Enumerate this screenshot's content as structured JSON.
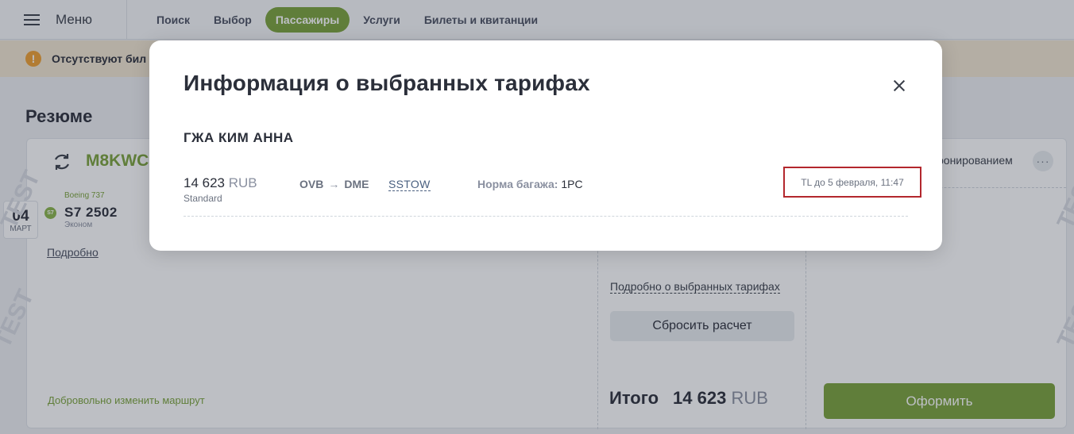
{
  "topbar": {
    "menu_label": "Меню",
    "tabs": [
      {
        "label": "Поиск",
        "active": false
      },
      {
        "label": "Выбор",
        "active": false
      },
      {
        "label": "Пассажиры",
        "active": true
      },
      {
        "label": "Услуги",
        "active": false
      },
      {
        "label": "Билеты и квитанции",
        "active": false
      }
    ]
  },
  "warning": {
    "icon": "exclamation-icon",
    "text": "Отсутствуют бил"
  },
  "summary": {
    "title": "Резюме",
    "pnr": "M8KWC",
    "date_day": "04",
    "date_month": "МАРТ",
    "carrier_code": "S7",
    "aircraft": "Boeing 737",
    "flight": "S7  2502",
    "cabin": "Эконом",
    "details_link": "Подробно",
    "change_route": "Добровольно изменить маршрут",
    "booking_hint": "ронированием",
    "fare_details_link": "Подробно о выбранных тарифах",
    "reset_button": "Сбросить расчет",
    "total_label": "Итого",
    "total_amount": "14 623",
    "total_currency": "RUB",
    "checkout_button": "Оформить",
    "watermark": "TEST"
  },
  "modal": {
    "title": "Информация о выбранных тарифах",
    "passenger": "ГЖА КИМ АННА",
    "price": "14 623",
    "currency": "RUB",
    "brand": "Standard",
    "origin": "OVB",
    "destination": "DME",
    "arrow": "→",
    "fare_basis": "SSTOW",
    "baggage_label": "Норма багажа:",
    "baggage_value": "1PC",
    "ticket_limit": "TL до 5 февраля, 11:47"
  },
  "colors": {
    "accent": "#7aa33a",
    "warning": "#f0a030",
    "highlight_border": "#b3272d"
  }
}
